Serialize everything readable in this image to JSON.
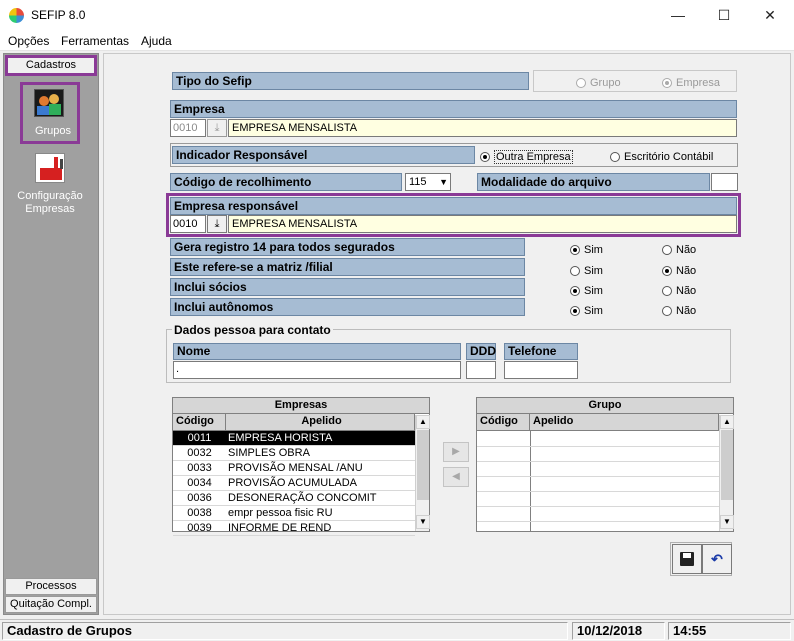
{
  "window": {
    "title": "SEFIP 8.0",
    "minimize": "—",
    "maximize": "☐",
    "close": "✕"
  },
  "menu": [
    "Opções",
    "Ferramentas",
    "Ajuda"
  ],
  "sidebar": {
    "cadastros": "Cadastros",
    "grupos": "Grupos",
    "config_line1": "Configuração",
    "config_line2": "Empresas",
    "processos": "Processos",
    "quitacao": "Quitação Compl."
  },
  "form": {
    "tipo_label": "Tipo do Sefip",
    "tipo_opt1": "Grupo",
    "tipo_opt2": "Empresa",
    "empresa_label": "Empresa",
    "empresa_code": "0010",
    "empresa_name": "EMPRESA MENSALISTA",
    "indicador_label": "Indicador Responsável",
    "ind_opt1": "Outra Empresa",
    "ind_opt2": "Escritório Contábil",
    "codigo_label": "Código de recolhimento",
    "codigo_value": "115",
    "modalidade_label": "Modalidade do arquivo",
    "resp_label": "Empresa responsável",
    "resp_code": "0010",
    "resp_name": "EMPRESA MENSALISTA",
    "q1": "Gera registro 14 para todos segurados",
    "q2": "Este refere-se a matriz /filial",
    "q3": "Inclui sócios",
    "q4": "Inclui autônomos",
    "sim": "Sim",
    "nao": "Não",
    "contato_title": "Dados pessoa para contato",
    "nome_label": "Nome",
    "ddd_label": "DDD",
    "tel_label": "Telefone",
    "nome_value": "."
  },
  "empresas": {
    "title": "Empresas",
    "col1": "Código",
    "col2": "Apelido",
    "rows": [
      [
        "0011",
        "EMPRESA HORISTA"
      ],
      [
        "0032",
        "SIMPLES OBRA"
      ],
      [
        "0033",
        "PROVISÃO MENSAL /ANU"
      ],
      [
        "0034",
        "PROVISÃO ACUMULADA"
      ],
      [
        "0036",
        "DESONERAÇÃO CONCOMIT"
      ],
      [
        "0038",
        "empr pessoa fisic RU"
      ],
      [
        "0039",
        "INFORME DE REND"
      ]
    ]
  },
  "grupo": {
    "title": "Grupo",
    "col1": "Código",
    "col2": "Apelido"
  },
  "status": {
    "title": "Cadastro de Grupos",
    "date": "10/12/2018",
    "time": "14:55"
  },
  "colors": {
    "header_bg": "#a6bcd3",
    "highlight": "#8a3a96",
    "field_bg": "#ffffe1",
    "sidebar_bg": "#a0a0a0"
  }
}
